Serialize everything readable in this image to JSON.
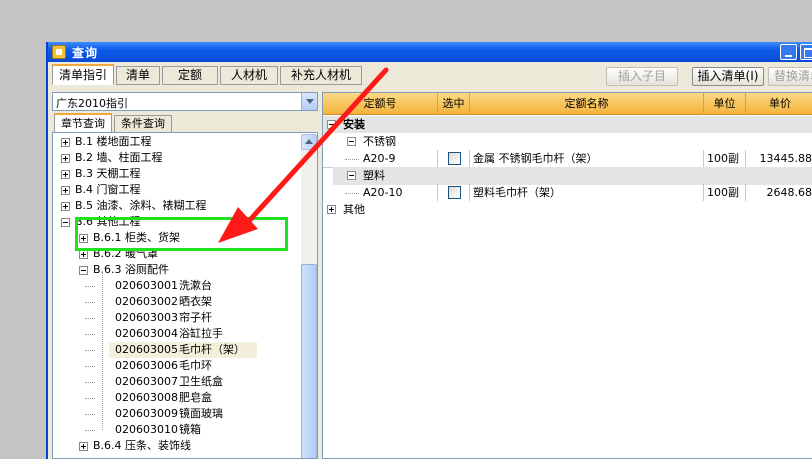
{
  "window": {
    "title": "查询"
  },
  "top_tabs": [
    {
      "label": "清单指引",
      "active": true
    },
    {
      "label": "清单",
      "active": false
    },
    {
      "label": "定额",
      "active": false
    },
    {
      "label": "人材机",
      "active": false
    },
    {
      "label": "补充人材机",
      "active": false
    }
  ],
  "toolbar": {
    "insert_child": "插入子目",
    "insert_list": "插入清单(I)",
    "replace_list": "替换清单"
  },
  "left": {
    "guide_select": "广东2010指引",
    "subtabs": [
      {
        "label": "章节查询",
        "active": true
      },
      {
        "label": "条件查询",
        "active": false
      }
    ],
    "tree": [
      {
        "text": "B.1  楼地面工程",
        "level": 1,
        "toggle": "plus"
      },
      {
        "text": "B.2  墙、柱面工程",
        "level": 1,
        "toggle": "plus"
      },
      {
        "text": "B.3  天棚工程",
        "level": 1,
        "toggle": "plus"
      },
      {
        "text": "B.4  门窗工程",
        "level": 1,
        "toggle": "plus"
      },
      {
        "text": "B.5  油漆、涂料、裱糊工程",
        "level": 1,
        "toggle": "plus"
      },
      {
        "text": "B.6  其他工程",
        "level": 1,
        "toggle": "minus"
      },
      {
        "text": "B.6.1  柜类、货架",
        "level": 2,
        "toggle": "plus"
      },
      {
        "text": "B.6.2  暖气罩",
        "level": 2,
        "toggle": "plus"
      },
      {
        "text": "B.6.3  浴厕配件",
        "level": 2,
        "toggle": "minus"
      },
      {
        "code": "020603001",
        "name": "洗漱台",
        "level": 3
      },
      {
        "code": "020603002",
        "name": "晒衣架",
        "level": 3
      },
      {
        "code": "020603003",
        "name": "帘子杆",
        "level": 3
      },
      {
        "code": "020603004",
        "name": "浴缸拉手",
        "level": 3
      },
      {
        "code": "020603005",
        "name": "毛巾杆（架）",
        "level": 3,
        "selected": true
      },
      {
        "code": "020603006",
        "name": "毛巾环",
        "level": 3
      },
      {
        "code": "020603007",
        "name": "卫生纸盒",
        "level": 3
      },
      {
        "code": "020603008",
        "name": "肥皂盒",
        "level": 3
      },
      {
        "code": "020603009",
        "name": "镜面玻璃",
        "level": 3
      },
      {
        "code": "020603010",
        "name": "镜箱",
        "level": 3
      },
      {
        "text": "B.6.4  压条、装饰线",
        "level": 2,
        "toggle": "plus"
      }
    ]
  },
  "grid": {
    "columns": [
      "定额号",
      "选中",
      "定额名称",
      "单位",
      "单价"
    ],
    "rows": [
      {
        "kind": "group",
        "level": 0,
        "toggle": "minus",
        "label": "安装",
        "bold": true,
        "shaded": true
      },
      {
        "kind": "group",
        "level": 1,
        "toggle": "minus",
        "label": "不锈钢",
        "shaded": false
      },
      {
        "kind": "item",
        "code": "A20-9",
        "checked": false,
        "name": "金属  不锈钢毛巾杆（架）",
        "unit": "100副",
        "price": "13445.88"
      },
      {
        "kind": "group",
        "level": 1,
        "toggle": "minus",
        "label": "塑料",
        "shaded": true
      },
      {
        "kind": "item",
        "code": "A20-10",
        "checked": false,
        "name": "塑料毛巾杆（架）",
        "unit": "100副",
        "price": "2648.68"
      },
      {
        "kind": "group",
        "level": 0,
        "toggle": "plus",
        "label": "其他",
        "shaded": false
      }
    ]
  },
  "colors": {
    "annotation_box": "#20e020",
    "annotation_arrow": "#ff1a1a",
    "header_orange": "#f3b33c"
  }
}
